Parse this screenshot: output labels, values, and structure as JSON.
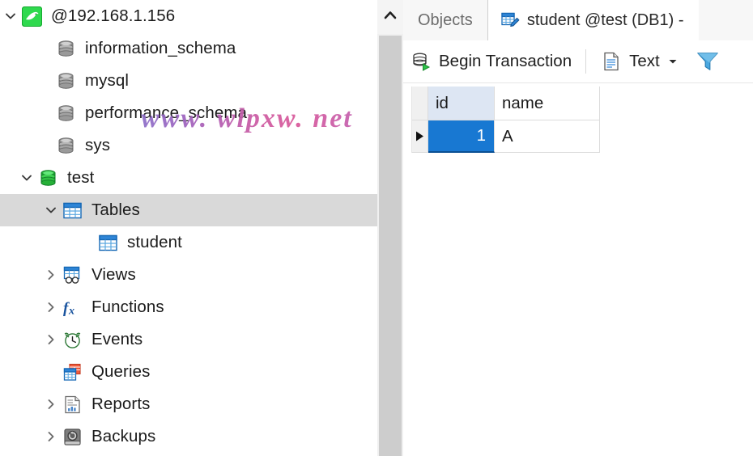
{
  "connection": {
    "name": "@192.168.1.156",
    "icon": "mysql-dolphin-icon"
  },
  "tree": {
    "items": [
      {
        "label": "@192.168.1.156",
        "icon": "mysql-connection-icon",
        "indent": 0,
        "twisty": "expanded",
        "selected": false
      },
      {
        "label": "information_schema",
        "icon": "database-icon",
        "indent": 1,
        "twisty": "none",
        "selected": false
      },
      {
        "label": "mysql",
        "icon": "database-icon",
        "indent": 1,
        "twisty": "none",
        "selected": false
      },
      {
        "label": "performance_schema",
        "icon": "database-icon",
        "indent": 1,
        "twisty": "none",
        "selected": false
      },
      {
        "label": "sys",
        "icon": "database-icon",
        "indent": 1,
        "twisty": "none",
        "selected": false
      },
      {
        "label": "test",
        "icon": "database-active-icon",
        "indent": 1,
        "twisty": "expanded",
        "selected": false
      },
      {
        "label": "Tables",
        "icon": "table-folder-icon",
        "indent": 2,
        "twisty": "expanded",
        "selected": true
      },
      {
        "label": "student",
        "icon": "table-icon",
        "indent": 3,
        "twisty": "none",
        "selected": false
      },
      {
        "label": "Views",
        "icon": "views-icon",
        "indent": 2,
        "twisty": "collapsed",
        "selected": false
      },
      {
        "label": "Functions",
        "icon": "functions-fx-icon",
        "indent": 2,
        "twisty": "collapsed",
        "selected": false
      },
      {
        "label": "Events",
        "icon": "events-clock-icon",
        "indent": 2,
        "twisty": "collapsed",
        "selected": false
      },
      {
        "label": "Queries",
        "icon": "queries-icon",
        "indent": 2,
        "twisty": "none",
        "selected": false
      },
      {
        "label": "Reports",
        "icon": "reports-icon",
        "indent": 2,
        "twisty": "collapsed",
        "selected": false
      },
      {
        "label": "Backups",
        "icon": "backups-disk-icon",
        "indent": 2,
        "twisty": "collapsed",
        "selected": false
      }
    ]
  },
  "scrollbar": {
    "up_icon": "chevron-up-icon"
  },
  "tabs": [
    {
      "label": "Objects",
      "icon": "",
      "active": false
    },
    {
      "label": "student @test (DB1) - ",
      "icon": "table-edit-icon",
      "active": true
    }
  ],
  "toolbar": {
    "begin_transaction_label": "Begin Transaction",
    "begin_transaction_icon": "database-play-icon",
    "text_label": "Text",
    "text_icon": "document-text-icon",
    "text_caret_icon": "chevron-down-icon",
    "filter_icon": "filter-funnel-icon"
  },
  "grid": {
    "columns": [
      "id",
      "name"
    ],
    "rows": [
      {
        "current": true,
        "id": "1",
        "name": "A"
      }
    ],
    "selected_cell": {
      "row": 0,
      "column": "id"
    },
    "row_indicator_icon": "current-row-arrow-icon"
  },
  "watermark": {
    "text": "www. wlpxw. net"
  },
  "colors": {
    "selection_blue": "#1878d2",
    "tree_selection_gray": "#d9d9d9",
    "accent_green": "#28c447"
  }
}
